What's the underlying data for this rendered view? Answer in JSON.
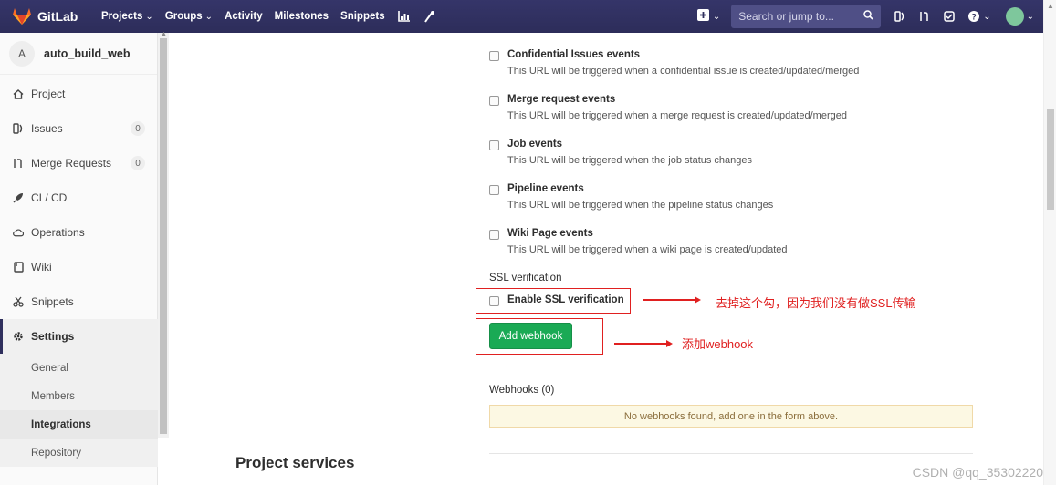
{
  "topnav": {
    "brand": "GitLab",
    "links": [
      {
        "label": "Projects",
        "dropdown": true
      },
      {
        "label": "Groups",
        "dropdown": true
      },
      {
        "label": "Activity",
        "dropdown": false
      },
      {
        "label": "Milestones",
        "dropdown": false
      },
      {
        "label": "Snippets",
        "dropdown": false
      }
    ],
    "search_placeholder": "Search or jump to...",
    "bg_color": "#2e2e5c"
  },
  "sidebar": {
    "project_initial": "A",
    "project_name": "auto_build_web",
    "items": [
      {
        "label": "Project",
        "icon": "home-icon"
      },
      {
        "label": "Issues",
        "icon": "issues-icon",
        "count": "0"
      },
      {
        "label": "Merge Requests",
        "icon": "merge-request-icon",
        "count": "0"
      },
      {
        "label": "CI / CD",
        "icon": "rocket-icon"
      },
      {
        "label": "Operations",
        "icon": "cloud-icon"
      },
      {
        "label": "Wiki",
        "icon": "book-icon"
      },
      {
        "label": "Snippets",
        "icon": "scissors-icon"
      },
      {
        "label": "Settings",
        "icon": "gear-icon"
      }
    ],
    "settings_sub": [
      "General",
      "Members",
      "Integrations",
      "Repository"
    ],
    "current_sub": "Integrations"
  },
  "events": [
    {
      "title": "Confidential Issues events",
      "desc": "This URL will be triggered when a confidential issue is created/updated/merged"
    },
    {
      "title": "Merge request events",
      "desc": "This URL will be triggered when a merge request is created/updated/merged"
    },
    {
      "title": "Job events",
      "desc": "This URL will be triggered when the job status changes"
    },
    {
      "title": "Pipeline events",
      "desc": "This URL will be triggered when the pipeline status changes"
    },
    {
      "title": "Wiki Page events",
      "desc": "This URL will be triggered when a wiki page is created/updated"
    }
  ],
  "ssl": {
    "section_label": "SSL verification",
    "checkbox_label": "Enable SSL verification",
    "checked": false
  },
  "add_webhook_label": "Add webhook",
  "annotations": {
    "ssl_note": "去掉这个勾，因为我们没有做SSL传输",
    "webhook_note": "添加webhook",
    "color": "#e02020"
  },
  "webhooks": {
    "title": "Webhooks (0)",
    "empty_message": "No webhooks found, add one in the form above."
  },
  "project_services_title": "Project services",
  "watermark": "CSDN @qq_35302220"
}
